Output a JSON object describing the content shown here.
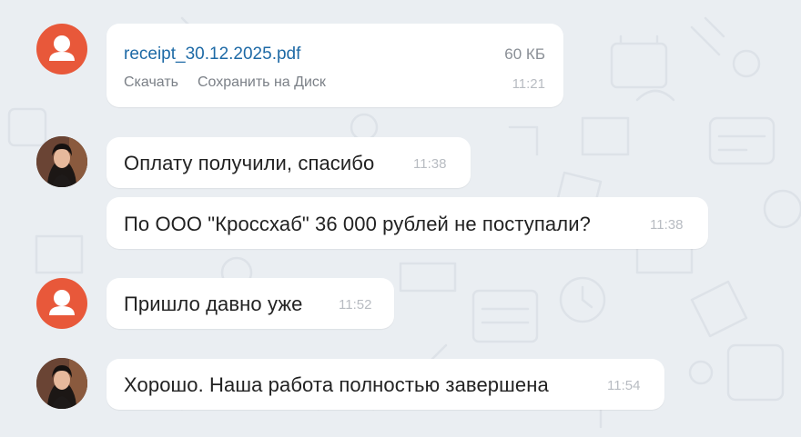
{
  "messages": [
    {
      "sender": "generic",
      "file": {
        "name": "receipt_30.12.2025.pdf",
        "size": "60 КБ",
        "action_download": "Скачать",
        "action_save": "Сохранить на Диск"
      },
      "time": "11:21"
    },
    {
      "sender": "photo",
      "text": "Оплату получили, спасибо",
      "time": "11:38"
    },
    {
      "sender": "photo",
      "text": "По ООО \"Кроссхаб\" 36 000 рублей не поступали?",
      "time": "11:38"
    },
    {
      "sender": "generic",
      "text": "Пришло давно уже",
      "time": "11:52"
    },
    {
      "sender": "photo",
      "text": "Хорошо. Наша работа полностью завершена",
      "time": "11:54"
    }
  ],
  "colors": {
    "background": "#eaeef2",
    "bubble": "#ffffff",
    "generic_avatar": "#e8583a",
    "file_link": "#1e6aa6",
    "timestamp": "#b8bcc2"
  },
  "icons": [
    "user-silhouette-icon",
    "contact-photo"
  ]
}
